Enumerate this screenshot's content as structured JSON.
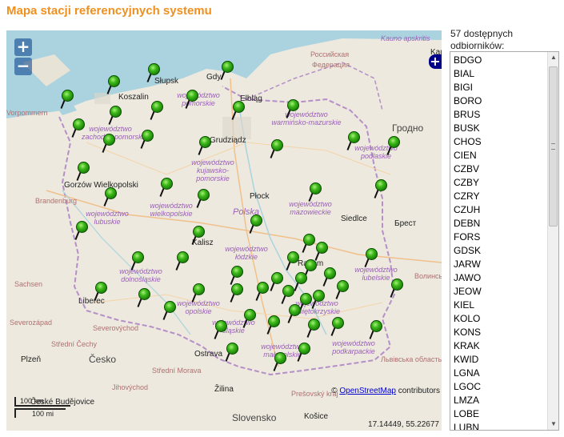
{
  "title": "Mapa stacji referencyjnych systemu",
  "map": {
    "zoom_in_label": "+",
    "zoom_out_label": "−",
    "layer_switch_label": "+",
    "attribution_prefix": "©",
    "attribution_link": "OpenStreetMap",
    "attribution_suffix": "contributors",
    "coordinates": "17.14449, 55.22677",
    "scale_km": "100 km",
    "scale_mi": "100 mi",
    "marker_color": "#2fa516",
    "labels": {
      "slupsk": "Słupsk",
      "gdynia": "Gdy",
      "koszalin": "Koszalin",
      "elblag": "Elbląg",
      "kaliningrad_ru": "Российская",
      "kaliningrad_fed": "Федерация",
      "kaunas": "Kaun",
      "grodno": "Гродно",
      "grudziadz": "Grudziądz",
      "gorzow": "Gorzów Wielkopolski",
      "plock": "Płock",
      "polska": "Polska",
      "siedlce": "Siedlce",
      "brest": "Брест",
      "kalisz": "Kalisz",
      "radom": "Radom",
      "sachsen": "Sachsen",
      "liberec": "Liberec",
      "severozapad": "Severozápad",
      "severovychod": "Severovýchod",
      "stredni_cechy": "Střední Čechy",
      "plzen": "Plzeň",
      "cesko": "Česko",
      "ostrava": "Ostrava",
      "stredni_morava": "Střední Morava",
      "jihovychod": "Jihovýchod",
      "ceske_budejovice": "České Budějovice",
      "zilina": "Žilina",
      "presovsky": "Prešovský kraj",
      "slovensko": "Slovensko",
      "kosice": "Košice",
      "brandenburg": "Brandenburg",
      "vorpommern": "Vorpommern",
      "volyn": "Волинськ",
      "lviv": "Львівська область",
      "kaunas_apsk": "Kauno apskritis",
      "zachodniopomorskie": "województwo zachodniopomorskie",
      "pomorskie": "województwo pomorskie",
      "warminsko": "województwo warmińsko-mazurskie",
      "podlaskie": "województwo podlaskie",
      "kujawsko": "województwo kujawsko-pomorskie",
      "wielkopolskie": "województwo wielkopolskie",
      "lubuskie": "województwo lubuskie",
      "mazowieckie": "województwo mazowieckie",
      "lodzkie": "województwo łódzkie",
      "lubelskie": "województwo lubelskie",
      "dolnoslaskie": "województwo dolnośląskie",
      "opolskie": "województwo opolskie",
      "slaskie": "województwo śląskie",
      "malopolskie": "województwo małopolskie",
      "podkarpackie": "województwo podkarpackie",
      "swietokrzyskie": "województwo świętokrzyskie"
    }
  },
  "stations_panel": {
    "count_label": "57 dostępnych odbiorników:",
    "items": [
      "BDGO",
      "BIAL",
      "BIGI",
      "BORO",
      "BRUS",
      "BUSK",
      "CHOS",
      "CIEN",
      "CZBV",
      "CZBY",
      "CZRY",
      "CZUH",
      "DEBN",
      "FORS",
      "GDSK",
      "JARW",
      "JAWO",
      "JEOW",
      "KIEL",
      "KOLO",
      "KONS",
      "KRAK",
      "KWID",
      "LGNA",
      "LGOC",
      "LMZA",
      "LOBE",
      "LUBN"
    ]
  }
}
